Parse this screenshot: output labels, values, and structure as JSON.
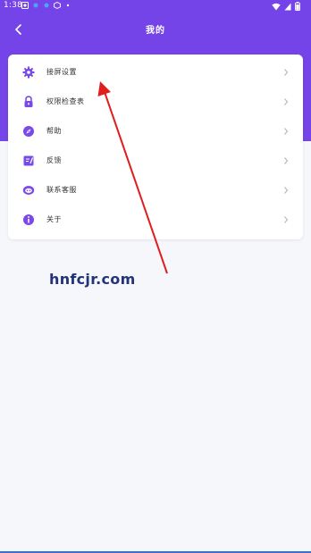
{
  "status_bar": {
    "time": "1:38"
  },
  "header": {
    "title": "我的"
  },
  "menu": {
    "items": [
      {
        "label": "接屏设置",
        "icon": "gear-icon"
      },
      {
        "label": "权限检查表",
        "icon": "lock-icon"
      },
      {
        "label": "帮助",
        "icon": "help-icon"
      },
      {
        "label": "反馈",
        "icon": "feedback-icon"
      },
      {
        "label": "联系客服",
        "icon": "customer-service-icon"
      },
      {
        "label": "关于",
        "icon": "info-icon"
      }
    ]
  },
  "watermark": {
    "text": "hnfcjr.com"
  },
  "colors": {
    "header": "#7444e8",
    "icon": "#7a4ae9",
    "background": "#f5f7fb",
    "annotation_arrow": "#e01e1e"
  }
}
